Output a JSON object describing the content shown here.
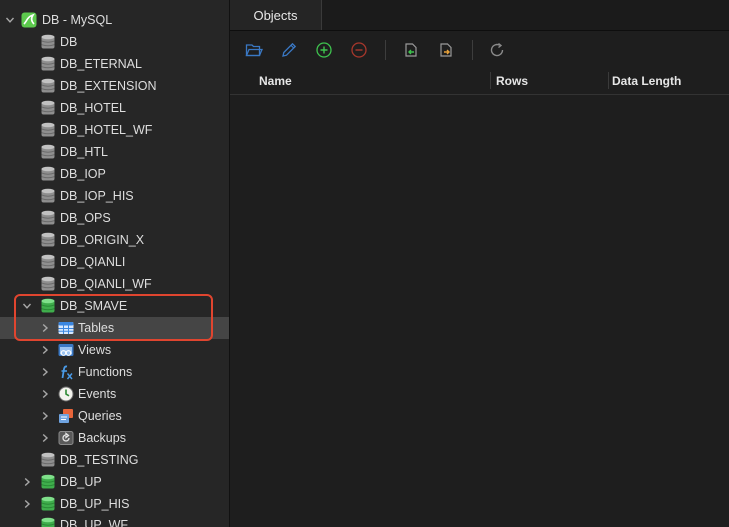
{
  "sidebar": {
    "connection_label": "DB - MySQL",
    "databases": [
      {
        "label": "DB"
      },
      {
        "label": "DB_ETERNAL"
      },
      {
        "label": "DB_EXTENSION"
      },
      {
        "label": "DB_HOTEL"
      },
      {
        "label": "DB_HOTEL_WF"
      },
      {
        "label": "DB_HTL"
      },
      {
        "label": "DB_IOP"
      },
      {
        "label": "DB_IOP_HIS"
      },
      {
        "label": "DB_OPS"
      },
      {
        "label": "DB_ORIGIN_X"
      },
      {
        "label": "DB_QIANLI"
      },
      {
        "label": "DB_QIANLI_WF"
      },
      {
        "label": "DB_SMAVE"
      },
      {
        "label": "DB_TESTING"
      },
      {
        "label": "DB_UP"
      },
      {
        "label": "DB_UP_HIS"
      },
      {
        "label": "DB_UP_WF"
      }
    ],
    "smave_children": [
      {
        "label": "Tables"
      },
      {
        "label": "Views"
      },
      {
        "label": "Functions"
      },
      {
        "label": "Events"
      },
      {
        "label": "Queries"
      },
      {
        "label": "Backups"
      }
    ],
    "selected_item": "Tables",
    "highlight_color": "#e0452f"
  },
  "main": {
    "tab_label": "Objects",
    "toolbar_icons": [
      "open-table-icon",
      "design-table-icon",
      "new-table-icon",
      "delete-table-icon",
      "import-icon",
      "export-icon",
      "refresh-icon"
    ],
    "columns": [
      "Name",
      "Rows",
      "Data Length"
    ]
  },
  "colors": {
    "db_gray": "#9a9a9a",
    "db_green": "#4cc25a",
    "add_green": "#3ec34e",
    "delete_red": "#c0392b",
    "toolbar_blue": "#3a78c4"
  }
}
